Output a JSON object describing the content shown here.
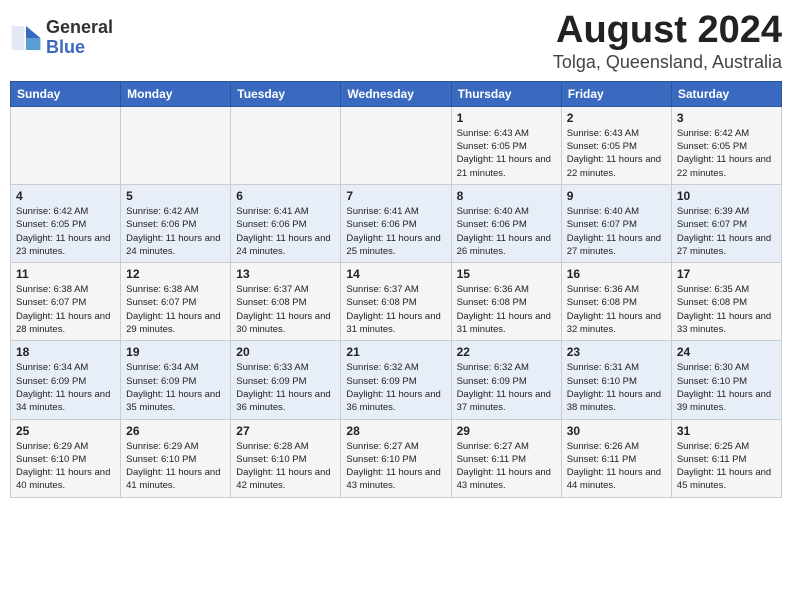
{
  "logo": {
    "general": "General",
    "blue": "Blue"
  },
  "title": "August 2024",
  "subtitle": "Tolga, Queensland, Australia",
  "days_of_week": [
    "Sunday",
    "Monday",
    "Tuesday",
    "Wednesday",
    "Thursday",
    "Friday",
    "Saturday"
  ],
  "weeks": [
    [
      {
        "day": "",
        "info": ""
      },
      {
        "day": "",
        "info": ""
      },
      {
        "day": "",
        "info": ""
      },
      {
        "day": "",
        "info": ""
      },
      {
        "day": "1",
        "info": "Sunrise: 6:43 AM\nSunset: 6:05 PM\nDaylight: 11 hours and 21 minutes."
      },
      {
        "day": "2",
        "info": "Sunrise: 6:43 AM\nSunset: 6:05 PM\nDaylight: 11 hours and 22 minutes."
      },
      {
        "day": "3",
        "info": "Sunrise: 6:42 AM\nSunset: 6:05 PM\nDaylight: 11 hours and 22 minutes."
      }
    ],
    [
      {
        "day": "4",
        "info": "Sunrise: 6:42 AM\nSunset: 6:05 PM\nDaylight: 11 hours and 23 minutes."
      },
      {
        "day": "5",
        "info": "Sunrise: 6:42 AM\nSunset: 6:06 PM\nDaylight: 11 hours and 24 minutes."
      },
      {
        "day": "6",
        "info": "Sunrise: 6:41 AM\nSunset: 6:06 PM\nDaylight: 11 hours and 24 minutes."
      },
      {
        "day": "7",
        "info": "Sunrise: 6:41 AM\nSunset: 6:06 PM\nDaylight: 11 hours and 25 minutes."
      },
      {
        "day": "8",
        "info": "Sunrise: 6:40 AM\nSunset: 6:06 PM\nDaylight: 11 hours and 26 minutes."
      },
      {
        "day": "9",
        "info": "Sunrise: 6:40 AM\nSunset: 6:07 PM\nDaylight: 11 hours and 27 minutes."
      },
      {
        "day": "10",
        "info": "Sunrise: 6:39 AM\nSunset: 6:07 PM\nDaylight: 11 hours and 27 minutes."
      }
    ],
    [
      {
        "day": "11",
        "info": "Sunrise: 6:38 AM\nSunset: 6:07 PM\nDaylight: 11 hours and 28 minutes."
      },
      {
        "day": "12",
        "info": "Sunrise: 6:38 AM\nSunset: 6:07 PM\nDaylight: 11 hours and 29 minutes."
      },
      {
        "day": "13",
        "info": "Sunrise: 6:37 AM\nSunset: 6:08 PM\nDaylight: 11 hours and 30 minutes."
      },
      {
        "day": "14",
        "info": "Sunrise: 6:37 AM\nSunset: 6:08 PM\nDaylight: 11 hours and 31 minutes."
      },
      {
        "day": "15",
        "info": "Sunrise: 6:36 AM\nSunset: 6:08 PM\nDaylight: 11 hours and 31 minutes."
      },
      {
        "day": "16",
        "info": "Sunrise: 6:36 AM\nSunset: 6:08 PM\nDaylight: 11 hours and 32 minutes."
      },
      {
        "day": "17",
        "info": "Sunrise: 6:35 AM\nSunset: 6:08 PM\nDaylight: 11 hours and 33 minutes."
      }
    ],
    [
      {
        "day": "18",
        "info": "Sunrise: 6:34 AM\nSunset: 6:09 PM\nDaylight: 11 hours and 34 minutes."
      },
      {
        "day": "19",
        "info": "Sunrise: 6:34 AM\nSunset: 6:09 PM\nDaylight: 11 hours and 35 minutes."
      },
      {
        "day": "20",
        "info": "Sunrise: 6:33 AM\nSunset: 6:09 PM\nDaylight: 11 hours and 36 minutes."
      },
      {
        "day": "21",
        "info": "Sunrise: 6:32 AM\nSunset: 6:09 PM\nDaylight: 11 hours and 36 minutes."
      },
      {
        "day": "22",
        "info": "Sunrise: 6:32 AM\nSunset: 6:09 PM\nDaylight: 11 hours and 37 minutes."
      },
      {
        "day": "23",
        "info": "Sunrise: 6:31 AM\nSunset: 6:10 PM\nDaylight: 11 hours and 38 minutes."
      },
      {
        "day": "24",
        "info": "Sunrise: 6:30 AM\nSunset: 6:10 PM\nDaylight: 11 hours and 39 minutes."
      }
    ],
    [
      {
        "day": "25",
        "info": "Sunrise: 6:29 AM\nSunset: 6:10 PM\nDaylight: 11 hours and 40 minutes."
      },
      {
        "day": "26",
        "info": "Sunrise: 6:29 AM\nSunset: 6:10 PM\nDaylight: 11 hours and 41 minutes."
      },
      {
        "day": "27",
        "info": "Sunrise: 6:28 AM\nSunset: 6:10 PM\nDaylight: 11 hours and 42 minutes."
      },
      {
        "day": "28",
        "info": "Sunrise: 6:27 AM\nSunset: 6:10 PM\nDaylight: 11 hours and 43 minutes."
      },
      {
        "day": "29",
        "info": "Sunrise: 6:27 AM\nSunset: 6:11 PM\nDaylight: 11 hours and 43 minutes."
      },
      {
        "day": "30",
        "info": "Sunrise: 6:26 AM\nSunset: 6:11 PM\nDaylight: 11 hours and 44 minutes."
      },
      {
        "day": "31",
        "info": "Sunrise: 6:25 AM\nSunset: 6:11 PM\nDaylight: 11 hours and 45 minutes."
      }
    ]
  ]
}
